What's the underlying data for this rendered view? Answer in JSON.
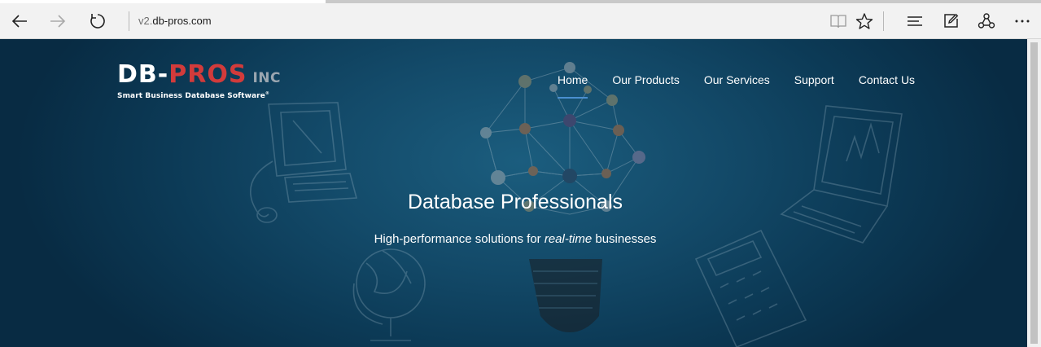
{
  "browser": {
    "url_prefix": "v2.",
    "url_host": "db-pros.com",
    "icons": {
      "back": "back-arrow-icon",
      "forward": "forward-arrow-icon",
      "refresh": "refresh-icon",
      "reading_view": "reading-view-icon",
      "favorite": "star-icon",
      "hub": "hub-icon",
      "web_note": "web-note-icon",
      "share": "share-icon",
      "more": "more-icon"
    }
  },
  "site": {
    "logo": {
      "prefix": "DB-",
      "brand": "PROS",
      "suffix": "INC",
      "tagline": "Smart Business Database Software",
      "mark": "®"
    },
    "nav": [
      {
        "label": "Home",
        "active": true
      },
      {
        "label": "Our Products"
      },
      {
        "label": "Our Services"
      },
      {
        "label": "Support"
      },
      {
        "label": "Contact Us"
      }
    ],
    "hero": {
      "title": "Database Professionals",
      "subtitle_pre": "High-performance solutions for ",
      "subtitle_em": "real-time",
      "subtitle_post": " businesses"
    }
  },
  "colors": {
    "brand_red": "#d23b3b",
    "hero_bg": "#134a69",
    "nav_active_underline": "#4a8fcf"
  }
}
